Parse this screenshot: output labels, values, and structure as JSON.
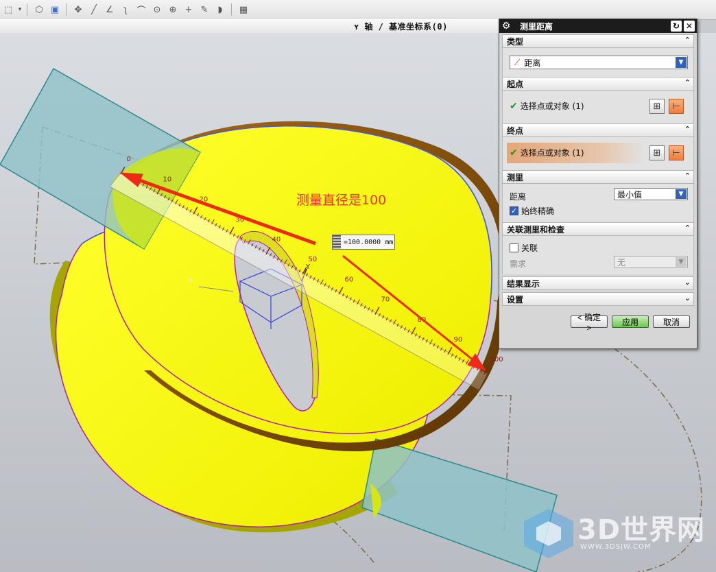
{
  "toolbar": {
    "icons": [
      "select-icon",
      "dropdown-icon",
      "view-shaded-icon",
      "view-box-icon",
      "move-icon",
      "line-icon",
      "angle-icon",
      "curve-icon",
      "arc-icon",
      "circle-icon",
      "circle-center-icon",
      "cross-icon",
      "pen-icon",
      "surface-icon",
      "table-icon"
    ]
  },
  "status": {
    "orient_text": "ʏ 轴 / 基准坐标系(0)"
  },
  "viewport": {
    "annotation": "测量直径是100",
    "measurement_value": "=100.0000 mm",
    "ruler_ticks": [
      "0",
      "10",
      "20",
      "30",
      "40",
      "50",
      "60",
      "70",
      "80",
      "90",
      "100"
    ],
    "axis_y": "Y",
    "axis_x": "X"
  },
  "dialog": {
    "title": "测里距离",
    "reset_icon": "reset-icon",
    "close_icon": "close-icon",
    "type": {
      "header": "类型",
      "selected": "距离"
    },
    "start": {
      "header": "起点",
      "label": "选择点或对象 (1)"
    },
    "end": {
      "header": "终点",
      "label": "选择点或对象 (1)"
    },
    "measure": {
      "header": "测里",
      "distance_label": "距离",
      "distance_value": "最小值",
      "accurate_label": "始终精确",
      "accurate_checked": true
    },
    "assoc": {
      "header": "关联测里和检查",
      "assoc_label": "关联",
      "assoc_checked": false,
      "need_label": "需求",
      "need_value": "无"
    },
    "result_header": "结果显示",
    "settings_header": "设置",
    "buttons": {
      "ok": "< 确定 >",
      "apply": "应用",
      "cancel": "取消"
    }
  },
  "watermark": {
    "brand": "3D世界网",
    "url": "WWW.3DSJW.COM"
  },
  "colors": {
    "face": "#f5f500",
    "edge": "#b31ab3",
    "plane": "#8ec2c8",
    "arrow": "#ee2a16",
    "dialog_title": "#1c1c1c"
  }
}
